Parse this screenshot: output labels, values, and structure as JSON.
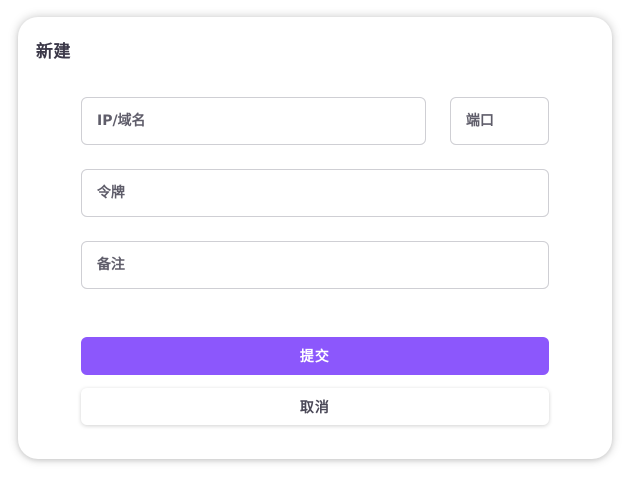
{
  "dialog": {
    "title": "新建"
  },
  "form": {
    "ip_placeholder": "IP/域名",
    "port_placeholder": "端口",
    "token_placeholder": "令牌",
    "note_placeholder": "备注"
  },
  "actions": {
    "submit_label": "提交",
    "cancel_label": "取消"
  },
  "colors": {
    "accent": "#8c57fc",
    "text": "#3b3848",
    "border": "#cfcfd4"
  }
}
